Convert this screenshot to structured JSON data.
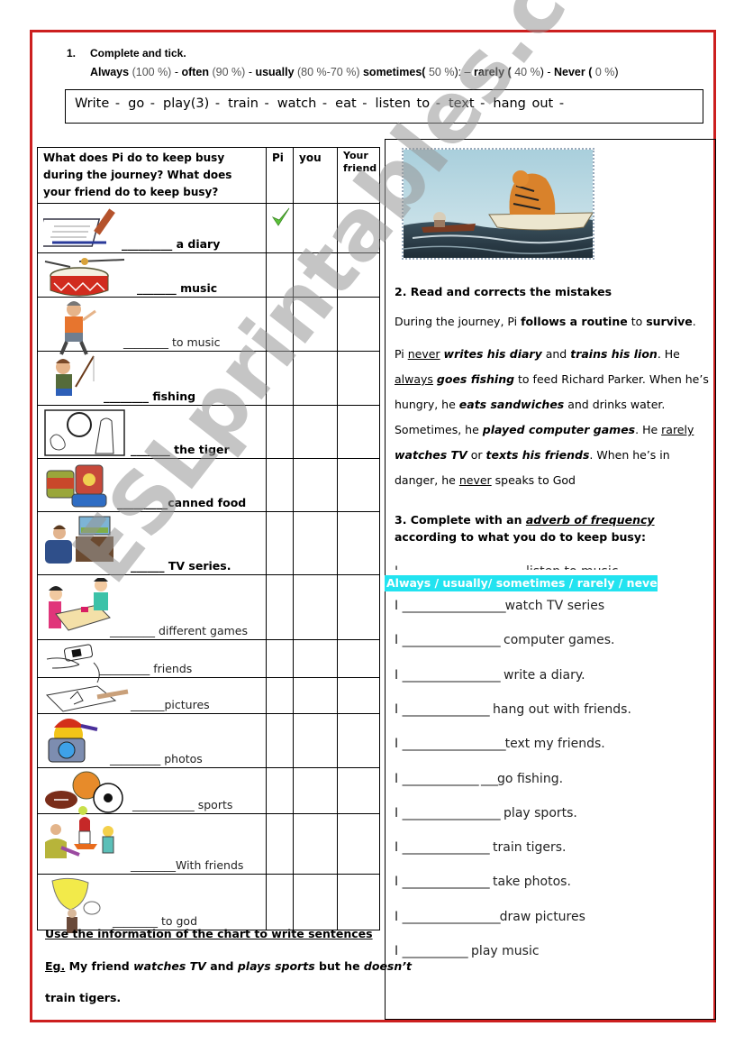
{
  "watermark": "ESLprintables.com",
  "task1": {
    "number": "1.",
    "title": "Complete and tick.",
    "frequencies": [
      {
        "word": "Always",
        "pct": "(100 %)",
        "sep": "   -"
      },
      {
        "word": "often",
        "pct": "(90 %)",
        "sep": "  -"
      },
      {
        "word": "usually",
        "pct": "(80 %-70 %)",
        "sep": ""
      },
      {
        "word": "sometimes(",
        "pct": "50 %",
        "sep": "): –"
      },
      {
        "word": "rarely (",
        "pct": "40 %",
        "sep": ") -"
      },
      {
        "word": "Never (",
        "pct": "0 %",
        "sep": ")"
      }
    ],
    "word_bank": [
      "Write  -",
      "go  -",
      "play(3)  -",
      "train -",
      "watch -",
      "eat -",
      "listen to -",
      "text -",
      "hang out  -"
    ]
  },
  "table": {
    "header": {
      "question": "What does Pi do to keep busy during the journey? What does your friend do to keep busy?",
      "col_pi": "Pi",
      "col_you": "you",
      "col_friend": "Your friend"
    },
    "rows": [
      {
        "picture": "diary-icon",
        "phrase": "_________ a diary",
        "style": "bold",
        "pi_checked": true
      },
      {
        "picture": "drum-icon",
        "phrase": "_______ music",
        "style": "bold",
        "pi_checked": false
      },
      {
        "picture": "listening-boy-icon",
        "phrase": "________ to music",
        "style": "light",
        "pi_checked": false
      },
      {
        "picture": "fishing-boy-icon",
        "phrase": "________ fishing",
        "style": "bold",
        "pi_checked": false
      },
      {
        "picture": "tiger-trainer-icon",
        "phrase": "_______ the tiger",
        "style": "bold",
        "pi_checked": false
      },
      {
        "picture": "canned-food-icon",
        "phrase": "_________canned food",
        "style": "bold",
        "pi_checked": false
      },
      {
        "picture": "tv-watcher-icon",
        "phrase": "______ TV series.",
        "style": "bold",
        "pi_checked": false
      },
      {
        "picture": "board-game-icon",
        "phrase": "________ different  games",
        "style": "light",
        "pi_checked": false
      },
      {
        "picture": "phone-texting-icon",
        "phrase": "_________ friends",
        "style": "light",
        "pi_checked": false
      },
      {
        "picture": "drawing-icon",
        "phrase": "______pictures",
        "style": "light",
        "pi_checked": false
      },
      {
        "picture": "camera-icon",
        "phrase": "_________ photos",
        "style": "light",
        "pi_checked": false
      },
      {
        "picture": "sports-balls-icon",
        "phrase": "___________ sports",
        "style": "light",
        "pi_checked": false
      },
      {
        "picture": "friends-hangout-icon",
        "phrase": "________With friends",
        "style": "light",
        "pi_checked": false
      },
      {
        "picture": "praying-man-icon",
        "phrase": "________ to god",
        "style": "light",
        "pi_checked": false
      }
    ]
  },
  "after_table": {
    "instruction": "Use the information of the chart to write sentences",
    "example_label": "Eg.",
    "example_parts": [
      {
        "t": " My friend ",
        "s": "n"
      },
      {
        "t": "watches TV",
        "s": "i"
      },
      {
        "t": " and ",
        "s": "n"
      },
      {
        "t": "plays sports",
        "s": "i"
      },
      {
        "t": " but he ",
        "s": "n"
      },
      {
        "t": "doesn’t",
        "s": "i"
      }
    ],
    "example_line2": "train tigers."
  },
  "task2": {
    "title": "2. Read and corrects the mistakes",
    "para1": [
      {
        "t": "During the journey, Pi  ",
        "s": "n"
      },
      {
        "t": "follows a routine",
        "s": "b"
      },
      {
        "t": " to ",
        "s": "n"
      },
      {
        "t": "survive",
        "s": "b"
      },
      {
        "t": ".",
        "s": "n"
      }
    ],
    "para2": [
      {
        "t": "Pi ",
        "s": "n"
      },
      {
        "t": "never",
        "s": "u"
      },
      {
        "t": " ",
        "s": "n"
      },
      {
        "t": "writes his diary",
        "s": "bi"
      },
      {
        "t": " and ",
        "s": "n"
      },
      {
        "t": "trains his lion",
        "s": "bi"
      },
      {
        "t": ". He ",
        "s": "n"
      },
      {
        "t": "always",
        "s": "u"
      },
      {
        "t": " ",
        "s": "n"
      },
      {
        "t": "goes fishing",
        "s": "bi"
      },
      {
        "t": " to feed Richard Parker.  When he’s hungry, he ",
        "s": "n"
      },
      {
        "t": "eats sandwiches",
        "s": "bi"
      },
      {
        "t": " and drinks water.  Sometimes, he ",
        "s": "n"
      },
      {
        "t": "played computer games",
        "s": "bi"
      },
      {
        "t": ". He ",
        "s": "n"
      },
      {
        "t": "rarely",
        "s": "u"
      },
      {
        "t": " ",
        "s": "n"
      },
      {
        "t": "watches TV",
        "s": "bi"
      },
      {
        "t": " or ",
        "s": "n"
      },
      {
        "t": "texts his friends",
        "s": "bi"
      },
      {
        "t": ".  When he’s in danger, he ",
        "s": "n"
      },
      {
        "t": "never",
        "s": "u"
      },
      {
        "t": " speaks to God",
        "s": "n"
      }
    ]
  },
  "task3": {
    "title_prefix": "3. Complete with an ",
    "title_emph": "adverb of frequency",
    "title_suffix": " according to what you do to keep busy:",
    "hidden_line": "I ___________________ listen to music",
    "adverbs": "Always  /  usually/ sometimes /  rarely  /  never",
    "sentences": [
      {
        "subject": "I",
        "blank": "___________________",
        "rest": "watch TV series"
      },
      {
        "subject": "I",
        "blank": "__________________",
        "rest": " computer games."
      },
      {
        "subject": "I",
        "blank": "__________________",
        "rest": " write a diary."
      },
      {
        "subject": "I",
        "blank": "________________",
        "rest": " hang out with friends."
      },
      {
        "subject": "I",
        "blank": "___________________",
        "rest": "text my friends."
      },
      {
        "subject": "I",
        "blank": "______________ ___",
        "rest": "go fishing."
      },
      {
        "subject": "I",
        "blank": "__________________",
        "rest": " play sports."
      },
      {
        "subject": "I",
        "blank": "________________",
        "rest": " train tigers."
      },
      {
        "subject": "I",
        "blank": "________________",
        "rest": " take photos."
      },
      {
        "subject": "I",
        "blank": "__________________",
        "rest": "draw pictures"
      },
      {
        "subject": "I",
        "blank": "____________",
        "rest": " play music"
      }
    ]
  },
  "colors": {
    "frame": "#cc1f1f",
    "adverb_highlight": "#22e3f0",
    "check": "#5cc23a"
  }
}
